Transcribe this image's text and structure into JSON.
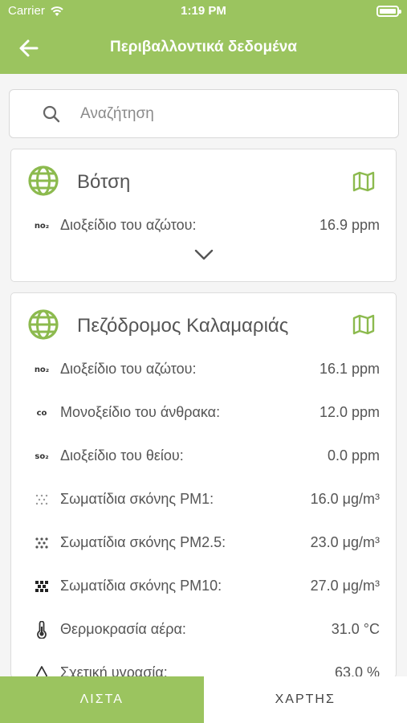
{
  "status_bar": {
    "carrier": "Carrier",
    "time": "1:19 PM"
  },
  "header": {
    "title": "Περιβαλλοντικά δεδομένα"
  },
  "search": {
    "placeholder": "Αναζήτηση"
  },
  "colors": {
    "accent": "#9bc45f",
    "text": "#555555"
  },
  "locations": [
    {
      "name": "Βότση",
      "measurements": [
        {
          "icon": "no2-icon",
          "icon_text": "no₂",
          "label": "Διοξείδιο του αζώτου:",
          "value": "16.9 ppm"
        }
      ]
    },
    {
      "name": "Πεζόδρομος Καλαμαριάς",
      "measurements": [
        {
          "icon": "no2-icon",
          "icon_text": "no₂",
          "label": "Διοξείδιο του αζώτου:",
          "value": "16.1 ppm"
        },
        {
          "icon": "co-icon",
          "icon_text": "co",
          "label": "Μονοξείδιο του άνθρακα:",
          "value": "12.0 ppm"
        },
        {
          "icon": "so2-icon",
          "icon_text": "so₂",
          "label": "Διοξείδιο του θείου:",
          "value": "0.0 ppm"
        },
        {
          "icon": "pm1-icon",
          "label": "Σωματίδια σκόνης PM1:",
          "value": "16.0 μg/m³"
        },
        {
          "icon": "pm25-icon",
          "label": "Σωματίδια σκόνης PM2.5:",
          "value": "23.0 μg/m³"
        },
        {
          "icon": "pm10-icon",
          "label": "Σωματίδια σκόνης PM10:",
          "value": "27.0 μg/m³"
        },
        {
          "icon": "thermometer-icon",
          "label": "Θερμοκρασία αέρα:",
          "value": "31.0 °C"
        },
        {
          "icon": "humidity-icon",
          "label": "Σχετική υγρασία:",
          "value": "63.0 %"
        }
      ]
    }
  ],
  "tabs": [
    {
      "label": "ΛΙΣΤΑ",
      "active": true
    },
    {
      "label": "ΧΑΡΤΗΣ",
      "active": false
    }
  ]
}
